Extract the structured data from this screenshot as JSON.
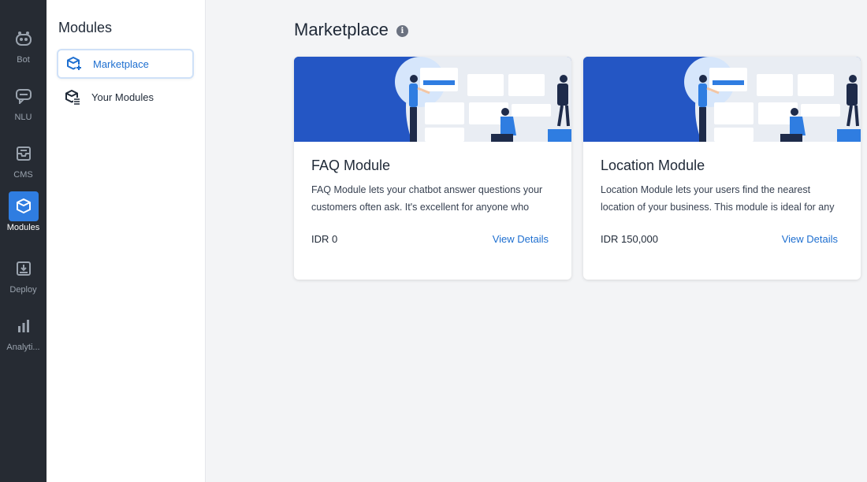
{
  "rail": {
    "items": [
      {
        "label": "Bot",
        "icon": "robot-icon"
      },
      {
        "label": "NLU",
        "icon": "chat-icon"
      },
      {
        "label": "CMS",
        "icon": "inbox-icon"
      },
      {
        "label": "Modules",
        "icon": "cube-icon",
        "active": true
      },
      {
        "label": "Deploy",
        "icon": "deploy-icon"
      },
      {
        "label": "Analyti...",
        "icon": "bar-chart-icon"
      }
    ]
  },
  "panel": {
    "title": "Modules",
    "items": [
      {
        "label": "Marketplace",
        "icon": "marketplace-icon",
        "active": true
      },
      {
        "label": "Your Modules",
        "icon": "your-modules-icon"
      }
    ]
  },
  "main": {
    "title": "Marketplace",
    "info_glyph": "i",
    "cards": [
      {
        "title": "FAQ Module",
        "description": "FAQ Module lets your chatbot answer questions your customers often ask. It's excellent for anyone who wants",
        "price": "IDR 0",
        "link": "View Details"
      },
      {
        "title": "Location Module",
        "description": "Location Module lets your users find the nearest location of your business. This module is ideal for any industries",
        "price": "IDR 150,000",
        "link": "View Details"
      }
    ]
  },
  "colors": {
    "rail_bg": "#262b33",
    "accent": "#2f7de1",
    "link": "#1e6fd0",
    "banner_blue": "#1f4fb8"
  }
}
